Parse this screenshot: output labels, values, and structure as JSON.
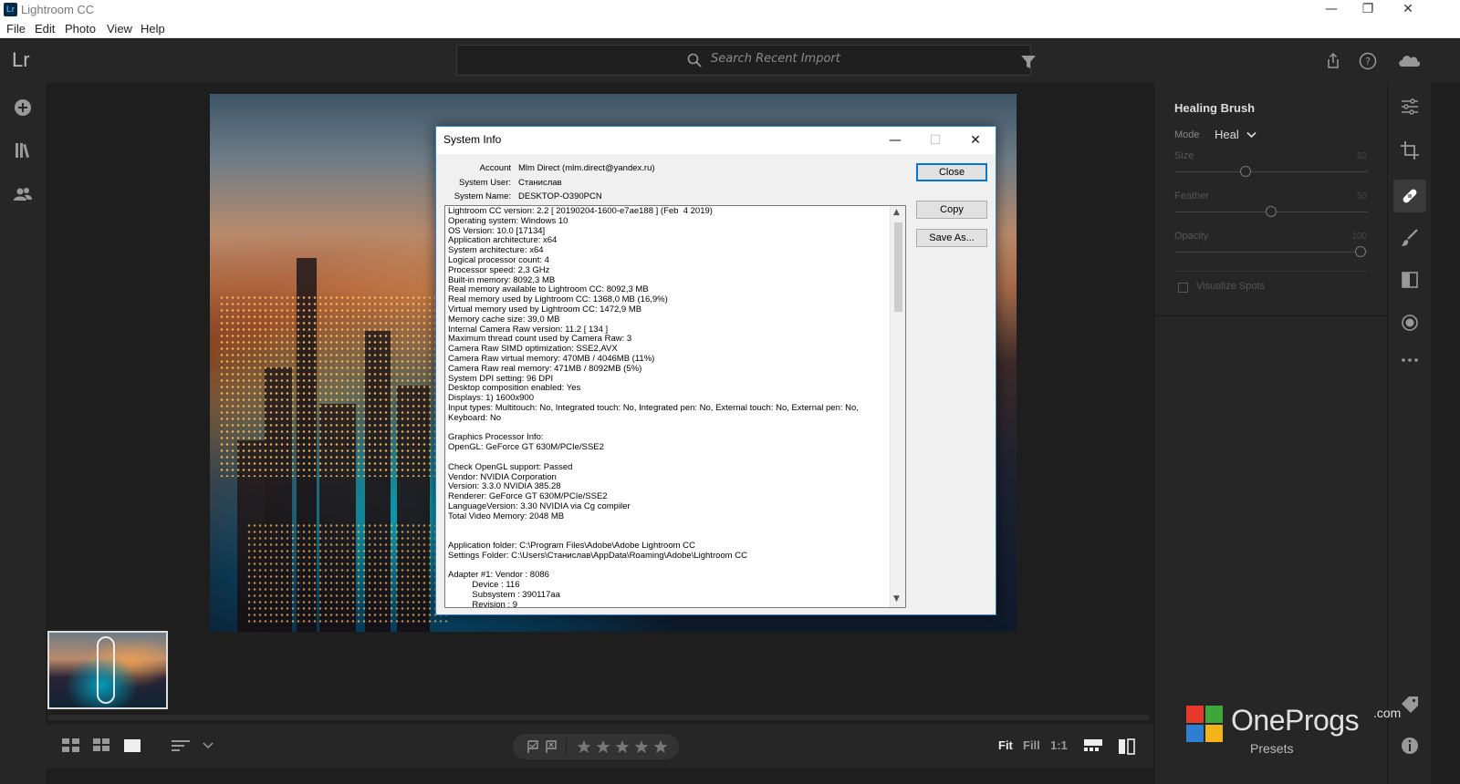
{
  "window": {
    "title": "Lightroom CC",
    "logo_text": "Lr",
    "minimize": "—",
    "restore": "❐",
    "close": "✕"
  },
  "menu": [
    "File",
    "Edit",
    "Photo",
    "View",
    "Help"
  ],
  "toolbar": {
    "brand_mark": "Lr",
    "search_placeholder": "Search Recent Import"
  },
  "right_panel": {
    "tool_title": "Healing Brush",
    "mode_label": "Mode",
    "mode_value": "Heal",
    "sliders": [
      {
        "label": "Size",
        "value": "82",
        "fraction": 0.37
      },
      {
        "label": "Feather",
        "value": "50",
        "fraction": 0.5
      },
      {
        "label": "Opacity",
        "value": "100",
        "fraction": 1.0
      }
    ],
    "visualize_label": "Visualize Spots"
  },
  "bottom_bar": {
    "fit": "Fit",
    "fill": "Fill",
    "one_to_one": "1:1"
  },
  "watermark": {
    "brand": "OneProgs",
    "suffix": ".com",
    "presets": "Presets"
  },
  "dialog": {
    "title": "System Info",
    "controls": {
      "minimize": "—",
      "maximize": "☐",
      "close": "✕"
    },
    "header": [
      {
        "label": "Account",
        "value": "Mlm Direct (mlm.direct@yandex.ru)"
      },
      {
        "label": "System User:",
        "value": "Станислав"
      },
      {
        "label": "System Name:",
        "value": "DESKTOP-O390PCN"
      }
    ],
    "buttons": {
      "close": "Close",
      "copy": "Copy",
      "save_as": "Save As..."
    },
    "info_lines": [
      "Lightroom CC version: 2.2 [ 20190204-1600-e7ae188 ] (Feb  4 2019)",
      "Operating system: Windows 10",
      "OS Version: 10.0 [17134]",
      "Application architecture: x64",
      "System architecture: x64",
      "Logical processor count: 4",
      "Processor speed: 2,3 GHz",
      "Built-in memory: 8092,3 MB",
      "Real memory available to Lightroom CC: 8092,3 MB",
      "Real memory used by Lightroom CC: 1368,0 MB (16,9%)",
      "Virtual memory used by Lightroom CC: 1472,9 MB",
      "Memory cache size: 39,0 MB",
      "Internal Camera Raw version: 11.2 [ 134 ]",
      "Maximum thread count used by Camera Raw: 3",
      "Camera Raw SIMD optimization: SSE2,AVX",
      "Camera Raw virtual memory: 470MB / 4046MB (11%)",
      "Camera Raw real memory: 471MB / 8092MB (5%)",
      "System DPI setting: 96 DPI",
      "Desktop composition enabled: Yes",
      "Displays: 1) 1600x900",
      "Input types: Multitouch: No, Integrated touch: No, Integrated pen: No, External touch: No, External pen: No,",
      "Keyboard: No",
      "",
      "Graphics Processor Info:",
      "OpenGL: GeForce GT 630M/PCIe/SSE2",
      "",
      "Check OpenGL support: Passed",
      "Vendor: NVIDIA Corporation",
      "Version: 3.3.0 NVIDIA 385.28",
      "Renderer: GeForce GT 630M/PCIe/SSE2",
      "LanguageVersion: 3.30 NVIDIA via Cg compiler",
      "Total Video Memory: 2048 MB",
      "",
      "",
      "Application folder: C:\\Program Files\\Adobe\\Adobe Lightroom CC",
      "Settings Folder: C:\\Users\\Станислав\\AppData\\Roaming\\Adobe\\Lightroom CC",
      "",
      "Adapter #1: Vendor : 8086",
      "          Device : 116",
      "          Subsystem : 390117aa",
      "          Revision : 9"
    ]
  }
}
